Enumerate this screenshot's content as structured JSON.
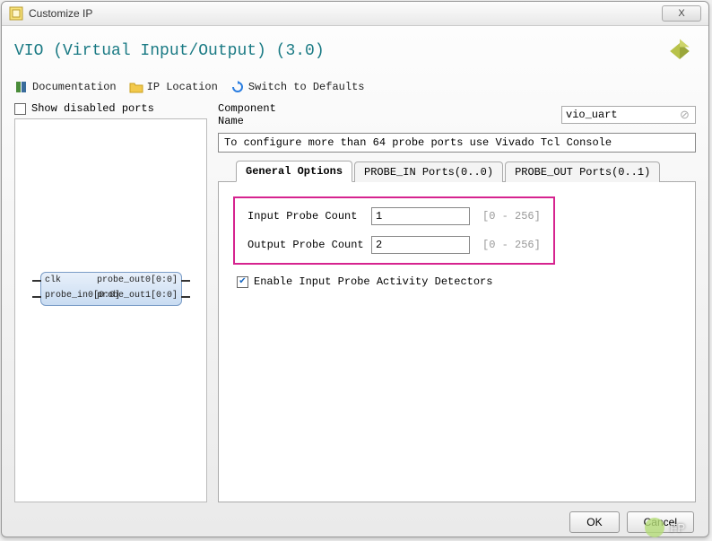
{
  "window": {
    "title": "Customize IP",
    "close": "X"
  },
  "page": {
    "title": "VIO (Virtual Input/Output) (3.0)"
  },
  "toolbar": {
    "documentation": "Documentation",
    "ip_location": "IP Location",
    "switch_defaults": "Switch to Defaults"
  },
  "left": {
    "show_disabled": "Show disabled ports",
    "ports": {
      "clk": "clk",
      "probe_in0": "probe_in0[0:0]",
      "probe_out0": "probe_out0[0:0]",
      "probe_out1": "probe_out1[0:0]"
    }
  },
  "right": {
    "component_name_label": "Component Name",
    "component_name_value": "vio_uart",
    "info": "To configure more than 64 probe ports use Vivado Tcl Console",
    "tabs": {
      "general": "General Options",
      "probe_in": "PROBE_IN Ports(0..0)",
      "probe_out": "PROBE_OUT Ports(0..1)"
    },
    "input_probe_label": "Input  Probe  Count",
    "input_probe_value": "1",
    "input_probe_range": "[0 - 256]",
    "output_probe_label": "Output Probe Count",
    "output_probe_value": "2",
    "output_probe_range": "[0 - 256]",
    "enable_activity": "Enable Input Probe Activity Detectors"
  },
  "footer": {
    "ok": "OK",
    "cancel": "Cancel"
  },
  "watermark": "FP"
}
